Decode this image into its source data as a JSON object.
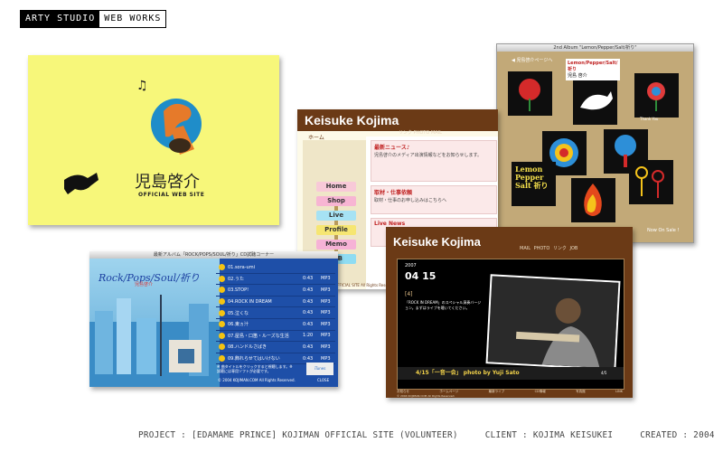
{
  "header": {
    "logo_left": "ARTY STUDIO",
    "logo_right": "WEB WORKS"
  },
  "card1": {
    "name": "児島啓介",
    "sub": "OFFICIAL WEB SITE",
    "accent": "#f7f77a"
  },
  "card2": {
    "title": "Keisuke Kojima",
    "nav": "リンク  PHOTO  MAIL",
    "home": "ホーム",
    "news_title": "最新ニュース♪",
    "news_text": "児島啓介のメディア出演情報などをお知らせします。",
    "work_title": "取材・仕事依頼",
    "work_text": "取材・仕事のお申し込みはこちらへ",
    "live_title": "Live News",
    "signs": [
      "Home",
      "Shop",
      "Live",
      "Profile",
      "Memo",
      "JOB"
    ],
    "footer": "© 2004 KOJIMAN OFFICIAL SITE All Rights Reserved."
  },
  "card3": {
    "window_title": "2nd Album \"Lemon/Pepper/Salt/祈り\"",
    "link": "◀ 児島啓介ページへ",
    "label_title": "Lemon/Pepper/Salt/祈り",
    "label_sub": "児島 啓介",
    "lemon": "Lemon Pepper Salt 祈り",
    "thankyou": "Thank You",
    "sale": "Now On Sale !"
  },
  "card4": {
    "window_title": "最新アルバム「ROCK/POPS/SOUL/祈り」CD試聴コーナー",
    "title": "Rock/Pops/Soul/祈り",
    "subtitle": "児島啓介",
    "tracks": [
      {
        "n": "1",
        "t": "01.sora-umi",
        "time": "",
        "fmt": ""
      },
      {
        "n": "2",
        "t": "02.うた",
        "time": "0:43",
        "fmt": "MP3"
      },
      {
        "n": "3",
        "t": "03.STOP!",
        "time": "0:43",
        "fmt": "MP3"
      },
      {
        "n": "4",
        "t": "04.ROCK IN DREAM",
        "time": "0:43",
        "fmt": "MP3"
      },
      {
        "n": "5",
        "t": "05.泣くな",
        "time": "0:43",
        "fmt": "MP3"
      },
      {
        "n": "6",
        "t": "06.東ヵ汁",
        "time": "0:43",
        "fmt": "MP3"
      },
      {
        "n": "7",
        "t": "07.屋島・口笛・ルーズな生活",
        "time": "1:20",
        "fmt": "MP3"
      },
      {
        "n": "8",
        "t": "08.ハンドルさばき",
        "time": "0:43",
        "fmt": "MP3"
      },
      {
        "n": "9",
        "t": "09.飾れらせてはいけない",
        "time": "0:43",
        "fmt": "MP3"
      }
    ],
    "note": "※ 曲タイトルをクリックすると視聴します。※ 試聴には専用ソフトが必要です。",
    "itunes": "iTunes",
    "copy": "© 2004 KOJIMAN.COM All Rights Reserved.",
    "close": "CLOSE"
  },
  "card5": {
    "title": "Keisuke Kojima",
    "nav": "MAIL  PHOTO  リンク  JOB",
    "date": "2007",
    "day": "04 15",
    "idx": "[4]",
    "body": "「ROCK IN DREAM」のスペシャル演奏バージョン。まずはライブを聴いてください。",
    "caption": "4/15「一音一会」 photo by Yuji Sato",
    "page": "4/5",
    "bnav": [
      "お知らせ",
      "ホームページ",
      "最新ライブ",
      "CD情報",
      "写真館",
      "LINK"
    ],
    "copy": "© 2004 KOJIMAN.COM All Rights Reserved."
  },
  "footer": {
    "project": "PROJECT : [EDAMAME PRINCE] KOJIMAN OFFICIAL SITE (VOLUNTEER)",
    "client": "CLIENT : KOJIMA KEISUKEI",
    "created": "CREATED : 2004"
  }
}
